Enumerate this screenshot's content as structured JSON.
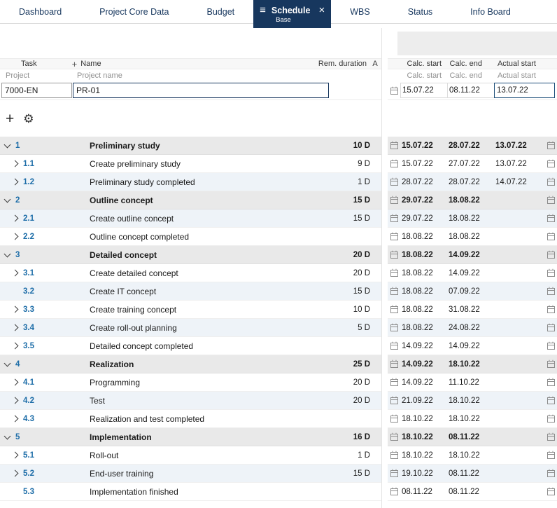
{
  "colors": {
    "accent_navy": "#17375e",
    "task_number_blue": "#1d6da8",
    "group_row_bg": "#e9e9e9",
    "alt_row_bg": "#eef3f8"
  },
  "icons": {
    "menu": "≡",
    "close": "×",
    "plus": "+",
    "gear": "⚙",
    "name_plus": "+",
    "calendar": "calendar-icon",
    "expand_collapse": "chevron-icon"
  },
  "tabs": [
    {
      "label": "Dashboard"
    },
    {
      "label": "Project Core Data"
    },
    {
      "label": "Budget"
    },
    {
      "label": "Schedule",
      "sublabel": "Base",
      "active": true
    },
    {
      "label": "WBS"
    },
    {
      "label": "Status"
    },
    {
      "label": "Info Board"
    }
  ],
  "headers": {
    "task": "Task",
    "name": "Name",
    "rem_duration": "Rem. duration",
    "a": "A",
    "calc_start": "Calc. start",
    "calc_end": "Calc. end",
    "actual_start": "Actual start"
  },
  "subheaders": {
    "project": "Project",
    "project_name": "Project name",
    "calc_start": "Calc. start",
    "calc_end": "Calc. end",
    "actual_start": "Actual start"
  },
  "project_row": {
    "id": "7000-EN",
    "name": "PR-01",
    "calc_start": "15.07.22",
    "calc_end": "08.11.22",
    "actual_start": "13.07.22"
  },
  "tasks": [
    {
      "number": "1",
      "name": "Preliminary study",
      "duration": "10 D",
      "calc_start": "15.07.22",
      "calc_end": "28.07.22",
      "actual_start": "13.07.22",
      "group": true,
      "chevron": "down"
    },
    {
      "number": "1.1",
      "name": "Create preliminary study",
      "duration": "9 D",
      "calc_start": "15.07.22",
      "calc_end": "27.07.22",
      "actual_start": "13.07.22",
      "group": false,
      "chevron": "right"
    },
    {
      "number": "1.2",
      "name": "Preliminary study completed",
      "duration": "1 D",
      "calc_start": "28.07.22",
      "calc_end": "28.07.22",
      "actual_start": "14.07.22",
      "group": false,
      "chevron": "right"
    },
    {
      "number": "2",
      "name": "Outline concept",
      "duration": "15 D",
      "calc_start": "29.07.22",
      "calc_end": "18.08.22",
      "actual_start": "",
      "group": true,
      "chevron": "down"
    },
    {
      "number": "2.1",
      "name": "Create outline concept",
      "duration": "15 D",
      "calc_start": "29.07.22",
      "calc_end": "18.08.22",
      "actual_start": "",
      "group": false,
      "chevron": "right"
    },
    {
      "number": "2.2",
      "name": "Outline concept completed",
      "duration": "",
      "calc_start": "18.08.22",
      "calc_end": "18.08.22",
      "actual_start": "",
      "group": false,
      "chevron": "right"
    },
    {
      "number": "3",
      "name": "Detailed concept",
      "duration": "20 D",
      "calc_start": "18.08.22",
      "calc_end": "14.09.22",
      "actual_start": "",
      "group": true,
      "chevron": "down"
    },
    {
      "number": "3.1",
      "name": "Create detailed concept",
      "duration": "20 D",
      "calc_start": "18.08.22",
      "calc_end": "14.09.22",
      "actual_start": "",
      "group": false,
      "chevron": "right"
    },
    {
      "number": "3.2",
      "name": "Create IT concept",
      "duration": "15 D",
      "calc_start": "18.08.22",
      "calc_end": "07.09.22",
      "actual_start": "",
      "group": false,
      "chevron": "none"
    },
    {
      "number": "3.3",
      "name": "Create training concept",
      "duration": "10 D",
      "calc_start": "18.08.22",
      "calc_end": "31.08.22",
      "actual_start": "",
      "group": false,
      "chevron": "right"
    },
    {
      "number": "3.4",
      "name": "Create roll-out planning",
      "duration": "5 D",
      "calc_start": "18.08.22",
      "calc_end": "24.08.22",
      "actual_start": "",
      "group": false,
      "chevron": "right"
    },
    {
      "number": "3.5",
      "name": "Detailed concept completed",
      "duration": "",
      "calc_start": "14.09.22",
      "calc_end": "14.09.22",
      "actual_start": "",
      "group": false,
      "chevron": "right"
    },
    {
      "number": "4",
      "name": "Realization",
      "duration": "25 D",
      "calc_start": "14.09.22",
      "calc_end": "18.10.22",
      "actual_start": "",
      "group": true,
      "chevron": "down"
    },
    {
      "number": "4.1",
      "name": "Programming",
      "duration": "20 D",
      "calc_start": "14.09.22",
      "calc_end": "11.10.22",
      "actual_start": "",
      "group": false,
      "chevron": "right"
    },
    {
      "number": "4.2",
      "name": "Test",
      "duration": "20 D",
      "calc_start": "21.09.22",
      "calc_end": "18.10.22",
      "actual_start": "",
      "group": false,
      "chevron": "right"
    },
    {
      "number": "4.3",
      "name": "Realization and test completed",
      "duration": "",
      "calc_start": "18.10.22",
      "calc_end": "18.10.22",
      "actual_start": "",
      "group": false,
      "chevron": "right"
    },
    {
      "number": "5",
      "name": "Implementation",
      "duration": "16 D",
      "calc_start": "18.10.22",
      "calc_end": "08.11.22",
      "actual_start": "",
      "group": true,
      "chevron": "down"
    },
    {
      "number": "5.1",
      "name": "Roll-out",
      "duration": "1 D",
      "calc_start": "18.10.22",
      "calc_end": "18.10.22",
      "actual_start": "",
      "group": false,
      "chevron": "right"
    },
    {
      "number": "5.2",
      "name": "End-user training",
      "duration": "15 D",
      "calc_start": "19.10.22",
      "calc_end": "08.11.22",
      "actual_start": "",
      "group": false,
      "chevron": "right"
    },
    {
      "number": "5.3",
      "name": "Implementation finished",
      "duration": "",
      "calc_start": "08.11.22",
      "calc_end": "08.11.22",
      "actual_start": "",
      "group": false,
      "chevron": "none"
    }
  ]
}
